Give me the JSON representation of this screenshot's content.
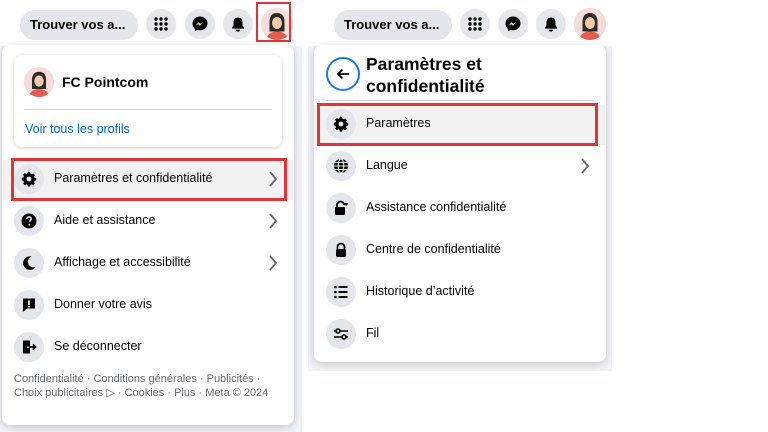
{
  "topbar": {
    "search_label": "Trouver vos a...",
    "icons": [
      "grid-icon",
      "messenger-icon",
      "bell-icon",
      "avatar"
    ]
  },
  "left_menu": {
    "profile": {
      "name": "FC Pointcom",
      "see_all_profiles": "Voir tous les profils"
    },
    "items": [
      {
        "label": "Paramètres et confidentialité",
        "icon": "gear-icon",
        "has_chevron": true,
        "highlighted": true
      },
      {
        "label": "Aide et assistance",
        "icon": "help-icon",
        "has_chevron": true
      },
      {
        "label": "Affichage et accessibilité",
        "icon": "moon-icon",
        "has_chevron": true
      },
      {
        "label": "Donner votre avis",
        "icon": "feedback-icon",
        "has_chevron": false
      },
      {
        "label": "Se déconnecter",
        "icon": "logout-icon",
        "has_chevron": false
      }
    ],
    "footer": "Confidentialité · Conditions générales · Publicités · Choix publicitaires ▷ · Cookies · Plus · Meta © 2024"
  },
  "right_menu": {
    "title": "Paramètres et confidentialité",
    "items": [
      {
        "label": "Paramètres",
        "icon": "gear-icon",
        "highlighted": true
      },
      {
        "label": "Langue",
        "icon": "globe-icon",
        "has_chevron": true
      },
      {
        "label": "Assistance confidentialité",
        "icon": "lock-heart-icon"
      },
      {
        "label": "Centre de confidentialité",
        "icon": "lock-icon"
      },
      {
        "label": "Historique d’activité",
        "icon": "list-icon"
      },
      {
        "label": "Fil",
        "icon": "sliders-icon"
      }
    ]
  },
  "colors": {
    "highlight": "#e0343a",
    "link": "#0064d1",
    "accent": "#1877f2"
  }
}
